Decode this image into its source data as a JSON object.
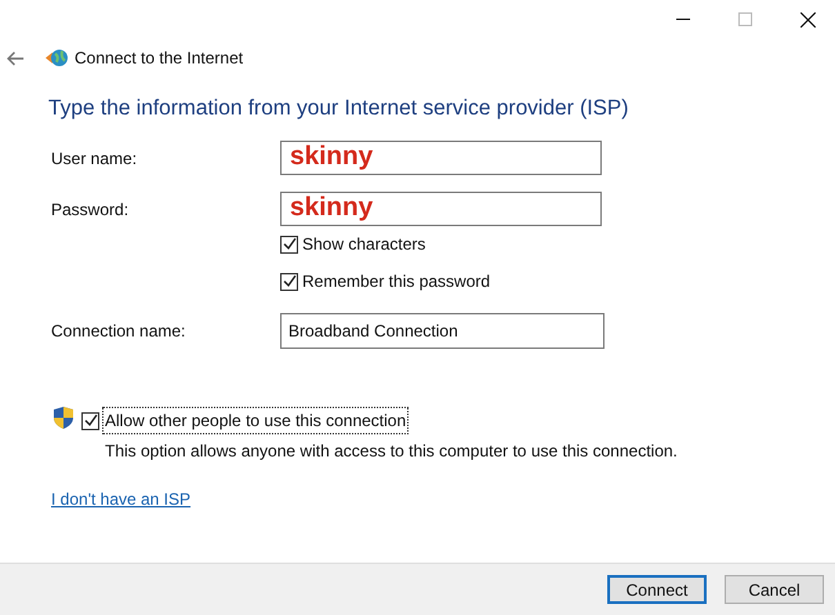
{
  "window": {
    "title": "Connect to the Internet"
  },
  "heading": "Type the information from your Internet service provider (ISP)",
  "fields": [
    {
      "label": "User name:",
      "value": "skinny",
      "kind": "emphasis"
    },
    {
      "label": "Password:",
      "value": "skinny",
      "kind": "emphasis"
    }
  ],
  "options": [
    {
      "label": "Show characters",
      "checked": true
    },
    {
      "label": "Remember this password",
      "checked": true
    }
  ],
  "connection_name": {
    "label": "Connection name:",
    "value": "Broadband Connection"
  },
  "allow_others": {
    "label": "Allow other people to use this connection",
    "checked": true,
    "description": "This option allows anyone with access to this computer to use this connection."
  },
  "link": "I don't have an ISP",
  "buttons": [
    {
      "label": "Connect",
      "selected": true
    },
    {
      "label": "Cancel",
      "selected": false
    }
  ]
}
